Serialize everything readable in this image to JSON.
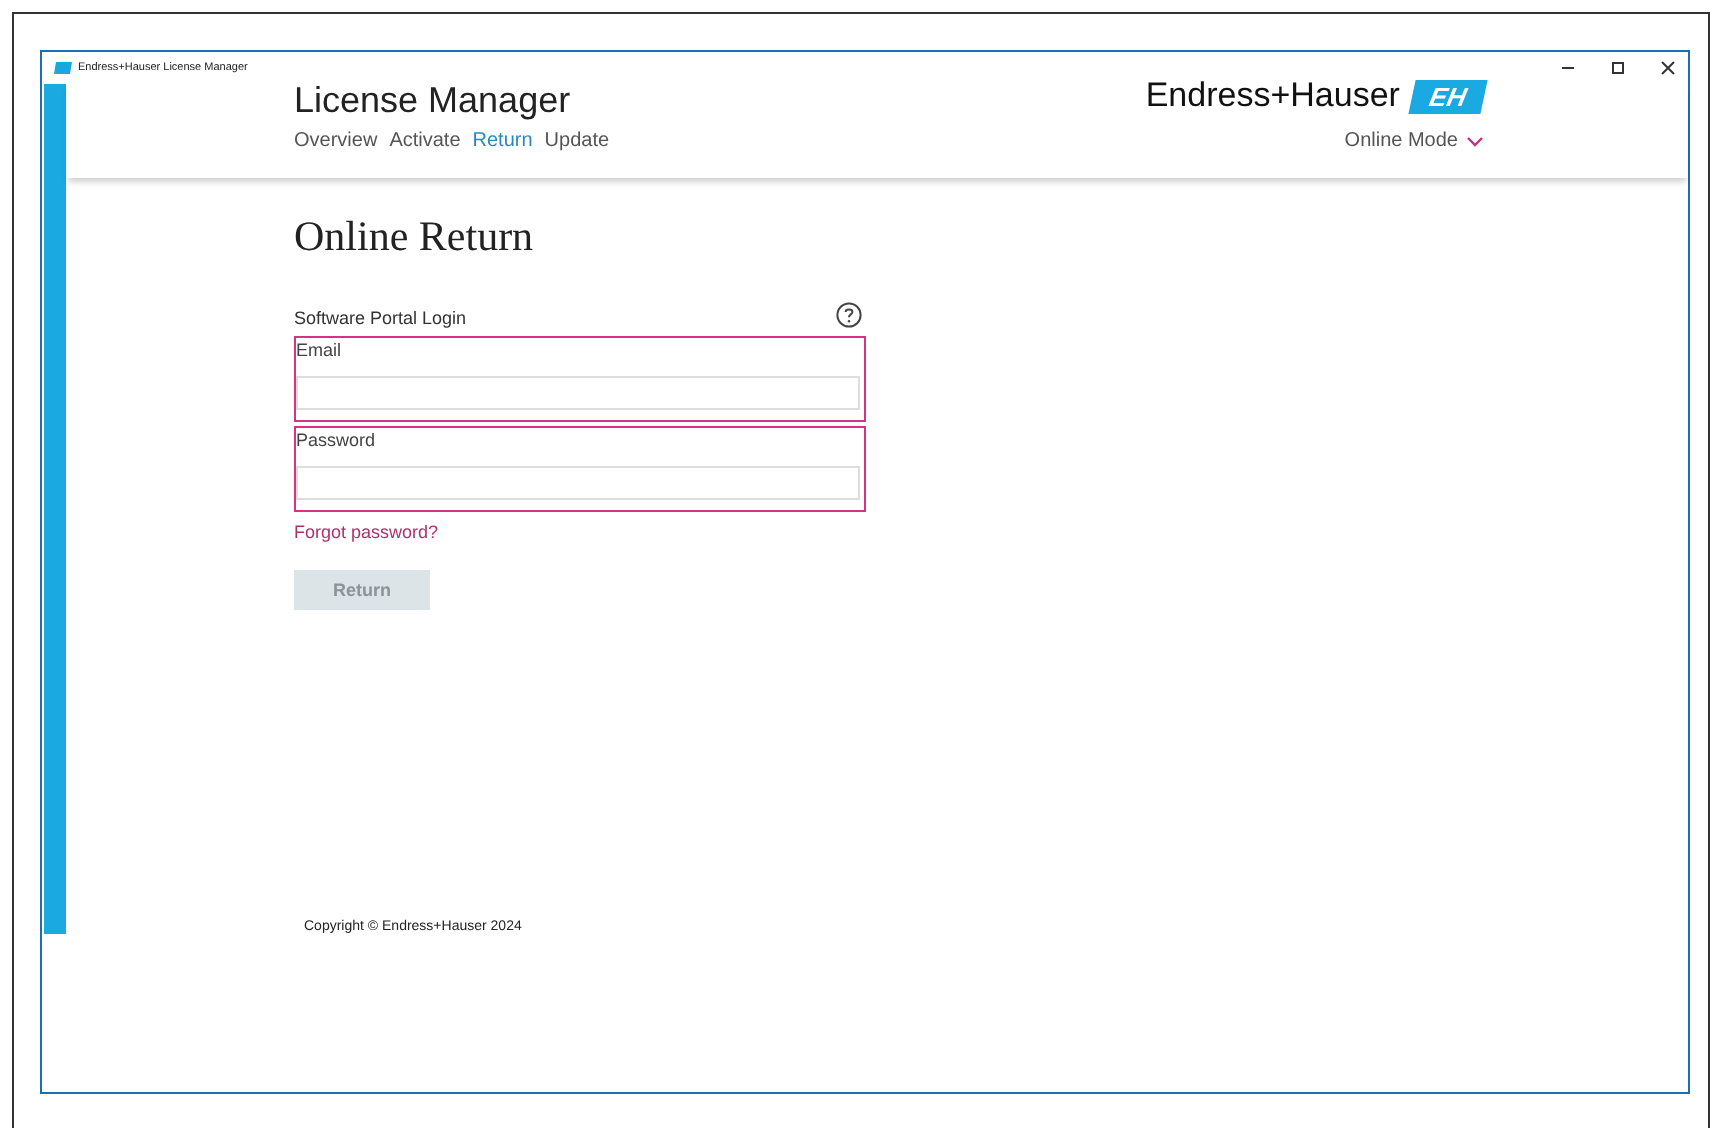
{
  "window": {
    "title": "Endress+Hauser License Manager"
  },
  "header": {
    "app_title": "License Manager",
    "nav": [
      {
        "label": "Overview",
        "selected": false
      },
      {
        "label": "Activate",
        "selected": false
      },
      {
        "label": "Return",
        "selected": true
      },
      {
        "label": "Update",
        "selected": false
      }
    ],
    "brand": "Endress+Hauser",
    "logo_text": "EH",
    "mode": "Online Mode"
  },
  "page": {
    "title": "Online Return",
    "section": "Software Portal Login",
    "fields": [
      {
        "label": "Email",
        "focused": true
      },
      {
        "label": "Password",
        "focused": true
      }
    ],
    "forgot_link": "Forgot password?",
    "submit": {
      "label": "Return",
      "disabled": true
    }
  },
  "footer": {
    "copyright": "Copyright © Endress+Hauser  2024"
  }
}
